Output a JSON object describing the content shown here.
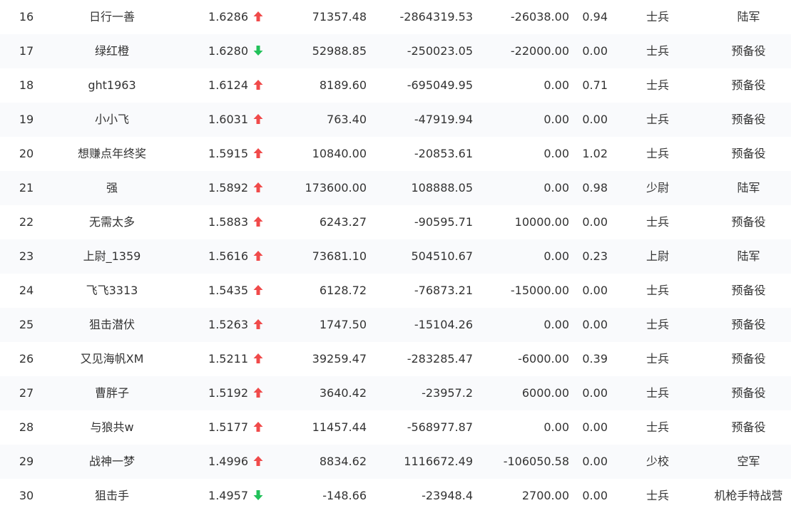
{
  "colors": {
    "up": "#f04a4a",
    "down": "#22c15a",
    "text": "#333333",
    "row_alt": "#f9fafc"
  },
  "rows": [
    {
      "rank": "16",
      "name": "日行一善",
      "nav": "1.6286",
      "trend": "up",
      "v1": "71357.48",
      "v2": "-2864319.53",
      "v3": "-26038.00",
      "v4": "0.94",
      "rank_title": "士兵",
      "branch": "陆军"
    },
    {
      "rank": "17",
      "name": "绿红橙",
      "nav": "1.6280",
      "trend": "down",
      "v1": "52988.85",
      "v2": "-250023.05",
      "v3": "-22000.00",
      "v4": "0.00",
      "rank_title": "士兵",
      "branch": "预备役"
    },
    {
      "rank": "18",
      "name": "ght1963",
      "nav": "1.6124",
      "trend": "up",
      "v1": "8189.60",
      "v2": "-695049.95",
      "v3": "0.00",
      "v4": "0.71",
      "rank_title": "士兵",
      "branch": "预备役"
    },
    {
      "rank": "19",
      "name": "小小飞",
      "nav": "1.6031",
      "trend": "up",
      "v1": "763.40",
      "v2": "-47919.94",
      "v3": "0.00",
      "v4": "0.00",
      "rank_title": "士兵",
      "branch": "预备役"
    },
    {
      "rank": "20",
      "name": "想赚点年终奖",
      "nav": "1.5915",
      "trend": "up",
      "v1": "10840.00",
      "v2": "-20853.61",
      "v3": "0.00",
      "v4": "1.02",
      "rank_title": "士兵",
      "branch": "预备役"
    },
    {
      "rank": "21",
      "name": "强",
      "nav": "1.5892",
      "trend": "up",
      "v1": "173600.00",
      "v2": "108888.05",
      "v3": "0.00",
      "v4": "0.98",
      "rank_title": "少尉",
      "branch": "陆军"
    },
    {
      "rank": "22",
      "name": "无需太多",
      "nav": "1.5883",
      "trend": "up",
      "v1": "6243.27",
      "v2": "-90595.71",
      "v3": "10000.00",
      "v4": "0.00",
      "rank_title": "士兵",
      "branch": "预备役"
    },
    {
      "rank": "23",
      "name": "上尉_1359",
      "nav": "1.5616",
      "trend": "up",
      "v1": "73681.10",
      "v2": "504510.67",
      "v3": "0.00",
      "v4": "0.23",
      "rank_title": "上尉",
      "branch": "陆军"
    },
    {
      "rank": "24",
      "name": "飞飞3313",
      "nav": "1.5435",
      "trend": "up",
      "v1": "6128.72",
      "v2": "-76873.21",
      "v3": "-15000.00",
      "v4": "0.00",
      "rank_title": "士兵",
      "branch": "预备役"
    },
    {
      "rank": "25",
      "name": "狙击潜伏",
      "nav": "1.5263",
      "trend": "up",
      "v1": "1747.50",
      "v2": "-15104.26",
      "v3": "0.00",
      "v4": "0.00",
      "rank_title": "士兵",
      "branch": "预备役"
    },
    {
      "rank": "26",
      "name": "又见海帆XM",
      "nav": "1.5211",
      "trend": "up",
      "v1": "39259.47",
      "v2": "-283285.47",
      "v3": "-6000.00",
      "v4": "0.39",
      "rank_title": "士兵",
      "branch": "预备役"
    },
    {
      "rank": "27",
      "name": "曹胖子",
      "nav": "1.5192",
      "trend": "up",
      "v1": "3640.42",
      "v2": "-23957.2",
      "v3": "6000.00",
      "v4": "0.00",
      "rank_title": "士兵",
      "branch": "预备役"
    },
    {
      "rank": "28",
      "name": "与狼共w",
      "nav": "1.5177",
      "trend": "up",
      "v1": "11457.44",
      "v2": "-568977.87",
      "v3": "0.00",
      "v4": "0.00",
      "rank_title": "士兵",
      "branch": "预备役"
    },
    {
      "rank": "29",
      "name": "战神一梦",
      "nav": "1.4996",
      "trend": "up",
      "v1": "8834.62",
      "v2": "1116672.49",
      "v3": "-106050.58",
      "v4": "0.00",
      "rank_title": "少校",
      "branch": "空军"
    },
    {
      "rank": "30",
      "name": "狙击手",
      "nav": "1.4957",
      "trend": "down",
      "v1": "-148.66",
      "v2": "-23948.4",
      "v3": "2700.00",
      "v4": "0.00",
      "rank_title": "士兵",
      "branch": "机枪手特战营"
    }
  ]
}
